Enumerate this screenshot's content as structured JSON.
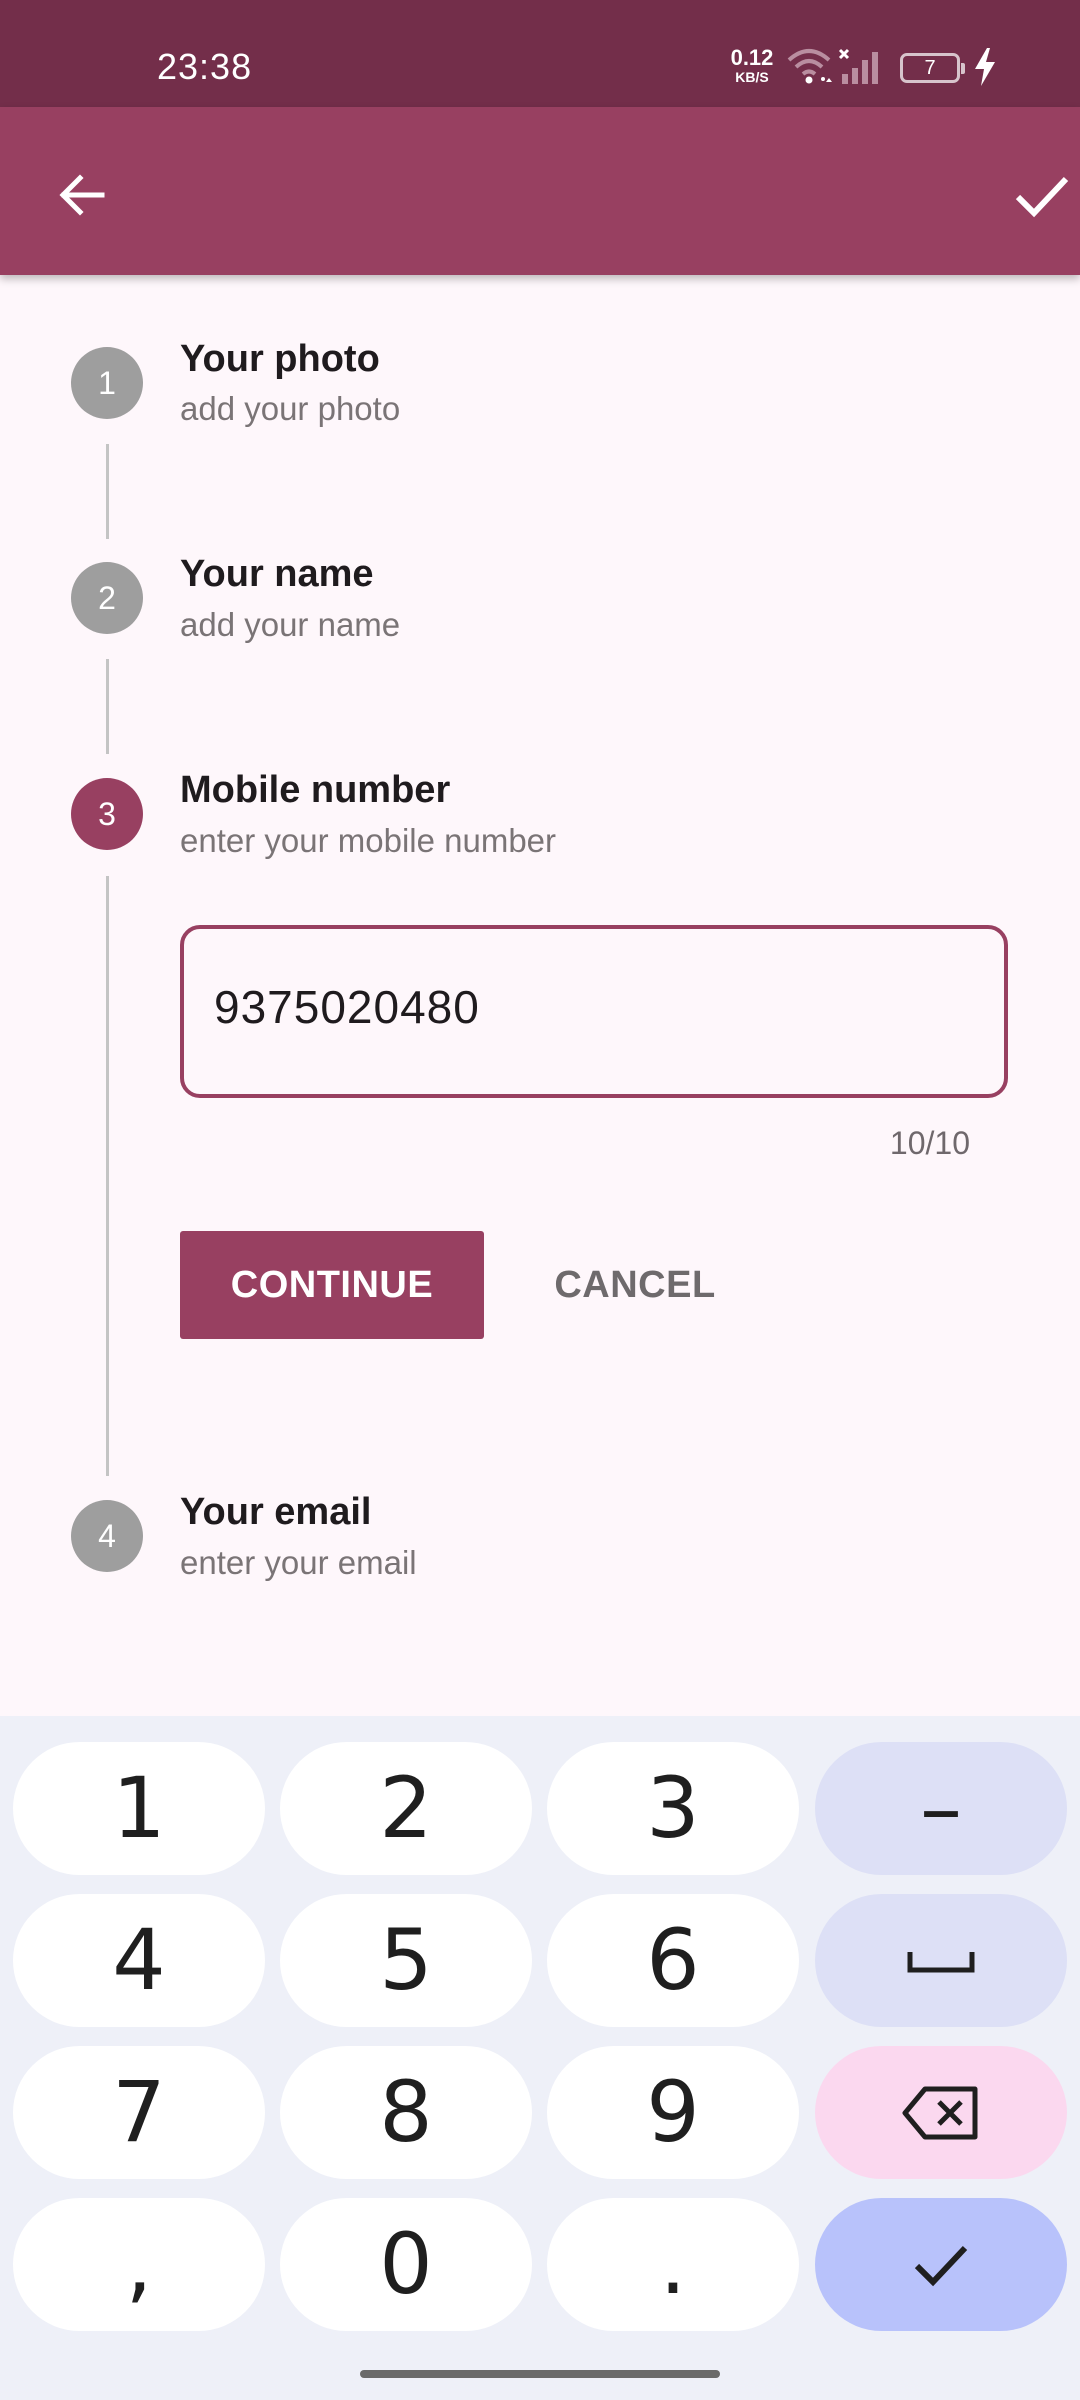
{
  "status_bar": {
    "time": "23:38",
    "net_speed_value": "0.12",
    "net_speed_unit": "KB/S",
    "battery_level": "7",
    "icons": [
      "wifi-icon",
      "signal-icon",
      "battery-icon",
      "charging-icon"
    ]
  },
  "app_bar": {
    "back_icon": "arrow-back-icon",
    "done_icon": "check-icon",
    "color": "#984061"
  },
  "steps": [
    {
      "number": "1",
      "title": "Your photo",
      "subtitle": "add your photo",
      "state": "inactive"
    },
    {
      "number": "2",
      "title": "Your name",
      "subtitle": "add your name",
      "state": "inactive"
    },
    {
      "number": "3",
      "title": "Mobile number",
      "subtitle": "enter your mobile number",
      "state": "active"
    },
    {
      "number": "4",
      "title": "Your email",
      "subtitle": "enter your email",
      "state": "inactive"
    }
  ],
  "mobile_field": {
    "value": "9375020480",
    "counter": "10/10"
  },
  "actions": {
    "continue_label": "CONTINUE",
    "cancel_label": "CANCEL"
  },
  "keyboard": {
    "row1": [
      "1",
      "2",
      "3",
      "–"
    ],
    "row2": [
      "4",
      "5",
      "6"
    ],
    "row3": [
      "7",
      "8",
      "9"
    ],
    "row4": [
      ",",
      "0",
      "."
    ],
    "special_icons": [
      "space-icon",
      "backspace-icon",
      "check-icon"
    ]
  },
  "colors": {
    "primary": "#984061",
    "status_bar": "#732e4a",
    "inactive_step": "#9e9e9e",
    "background": "#fef7fb"
  }
}
